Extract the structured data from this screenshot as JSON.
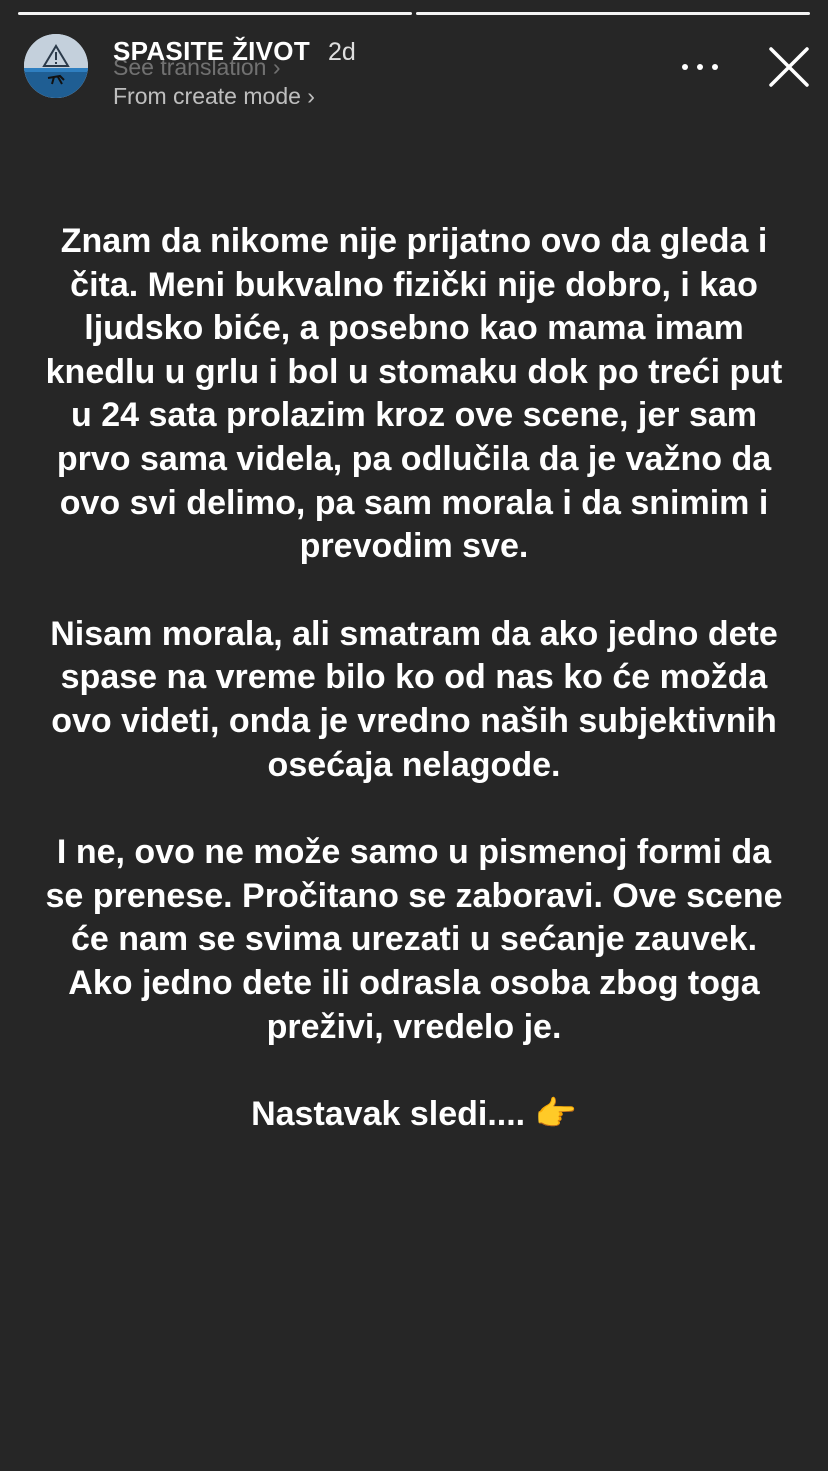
{
  "story": {
    "progress_segments": 2,
    "progress_done": 1,
    "username": "SPASITE ŽIVOT",
    "time_ago": "2d",
    "see_translation": "See translation ›",
    "create_mode": "From create mode ›",
    "avatar_icon": "warning-sign-underwater-icon",
    "more_icon": "more-horizontal-icon",
    "close_icon": "close-icon"
  },
  "paragraphs": [
    "Znam da nikome nije prijatno ovo da gleda i čita. Meni bukvalno fizički nije dobro, i kao ljudsko biće, a posebno kao mama imam knedlu u grlu i bol u stomaku dok po treći put u 24 sata prolazim kroz ove scene, jer sam prvo sama videla, pa odlučila da je važno da ovo svi delimo, pa sam morala i da snimim i prevodim sve.",
    "Nisam morala, ali smatram da ako jedno dete spase na vreme bilo ko od nas ko će možda ovo videti, onda je vredno naših subjektivnih osećaja nelagode.",
    "I ne, ovo ne može samo u pismenoj formi da se prenese. Pročitano se zaboravi. Ove scene će nam se svima urezati u sećanje zauvek. Ako jedno dete ili odrasla osoba zbog toga preživi, vredelo je.",
    "Nastavak sledi.... 👉"
  ],
  "colors": {
    "background": "#262626",
    "text": "#ffffff"
  }
}
